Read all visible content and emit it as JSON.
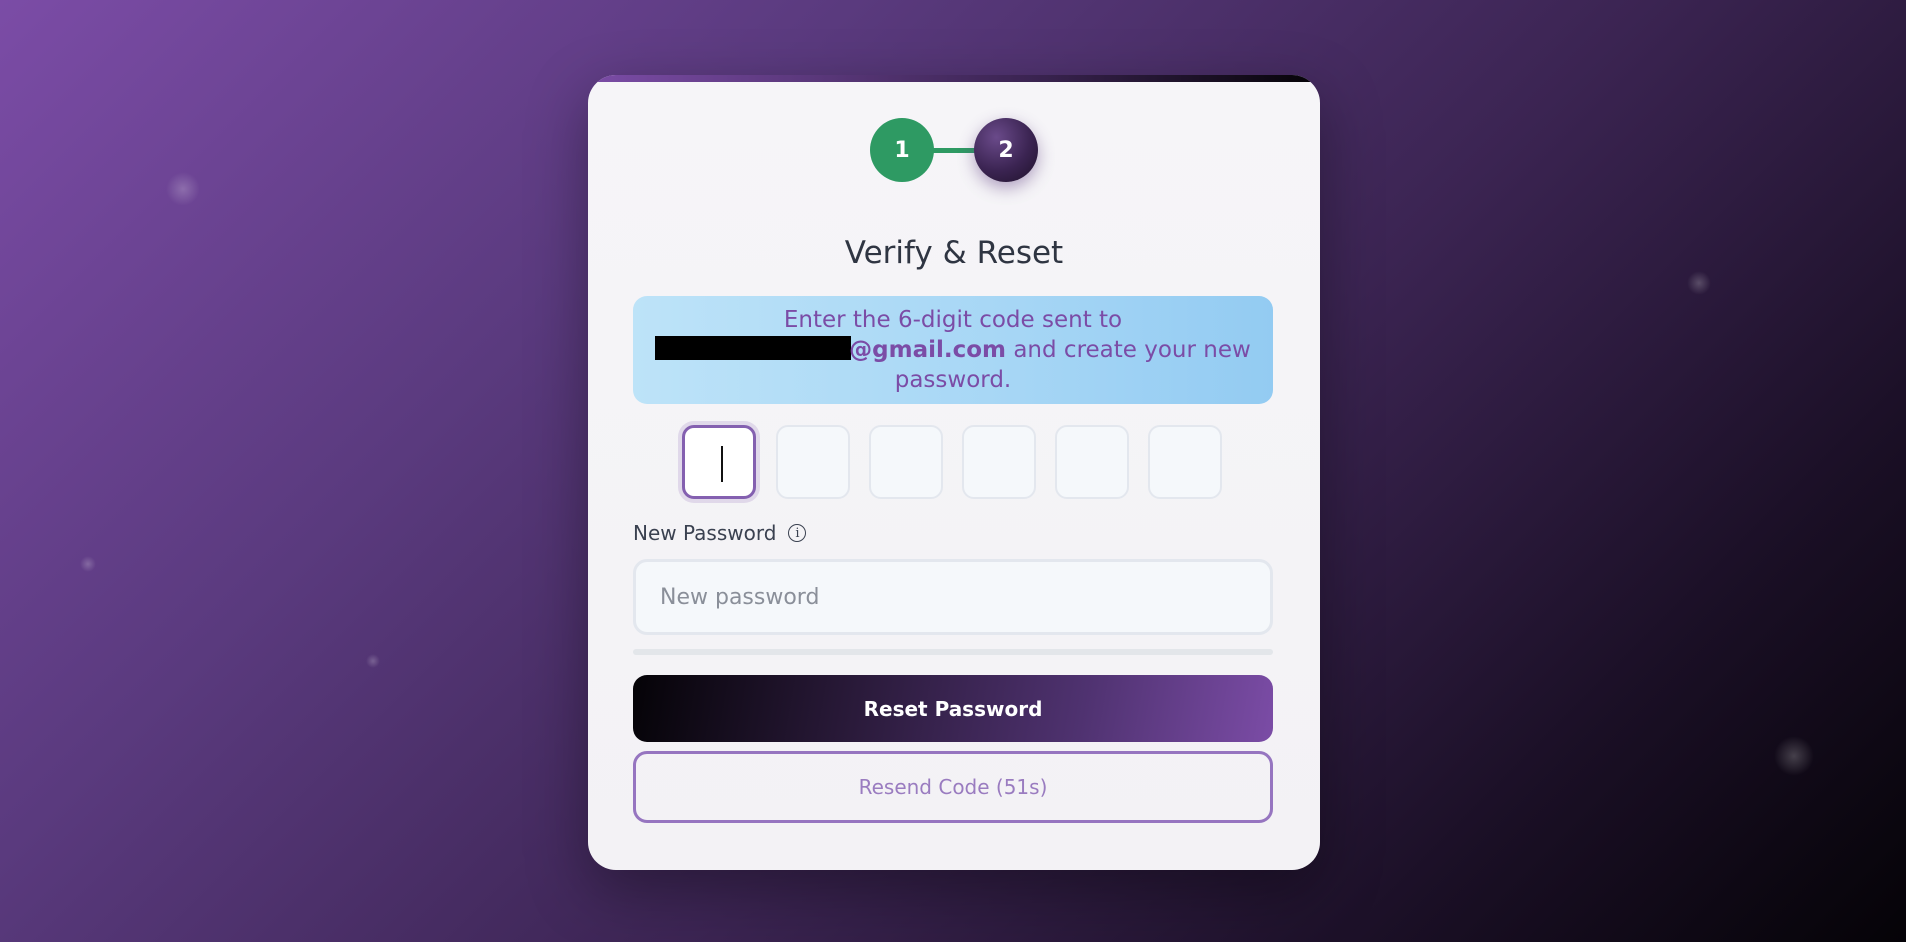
{
  "steps": [
    {
      "label": "1",
      "state": "completed",
      "color": "#2e9a63"
    },
    {
      "label": "2",
      "state": "active",
      "color": "#3b2452"
    }
  ],
  "title": "Verify & Reset",
  "info": {
    "line1": "Enter the 6-digit code sent to",
    "email_domain": "@gmail.com",
    "line2_rest": " and create your new",
    "line3": "password."
  },
  "otp": {
    "length": 6,
    "values": [
      "",
      "",
      "",
      "",
      "",
      ""
    ],
    "active_index": 0
  },
  "password": {
    "label": "New Password",
    "info_icon": "info-icon",
    "placeholder": "New password",
    "value": ""
  },
  "buttons": {
    "reset_label": "Reset Password",
    "resend_label": "Resend Code (51s)"
  },
  "colors": {
    "accent": "#7b4ca6",
    "success": "#2e9a63",
    "info_bg": "#a6d6f5"
  }
}
